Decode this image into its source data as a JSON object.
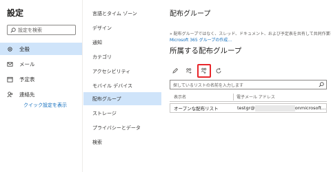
{
  "left": {
    "title": "設定",
    "search_placeholder": "設定を検索",
    "items": [
      {
        "label": "全般",
        "icon": "gear-icon",
        "active": true
      },
      {
        "label": "メール",
        "icon": "mail-icon"
      },
      {
        "label": "予定表",
        "icon": "calendar-icon"
      },
      {
        "label": "連絡先",
        "icon": "people-icon"
      }
    ],
    "quick_settings": "クイック設定を表示"
  },
  "categories": [
    "言語とタイム ゾーン",
    "デザイン",
    "通知",
    "カテゴリ",
    "アクセシビリティ",
    "モバイル デバイス",
    "配布グループ",
    "ストレージ",
    "プライバシーとデータ",
    "検索"
  ],
  "active_category": "配布グループ",
  "right": {
    "title": "配布グループ",
    "description": "» 配布グループではなく、スレッド、ドキュメント、および予定表を共有して共同作業を行う",
    "link": "Microsoft 365 グループの作成…",
    "subtitle": "所属する配布グループ",
    "toolbar_icons": [
      "pencil-icon",
      "join-group-icon",
      "create-group-icon",
      "refresh-icon"
    ],
    "filter_placeholder": "探しているリストの名前を入力します",
    "columns": [
      "表示名",
      "電子メール アドレス"
    ],
    "rows": [
      {
        "name": "オープンな配布リスト",
        "email_start": "testgr@",
        "email_end": "onmicrosoft..."
      }
    ]
  },
  "colors": {
    "accent": "#0f6cbd",
    "selected_bg": "#cfe4fa",
    "highlight_border": "#e8252a"
  }
}
